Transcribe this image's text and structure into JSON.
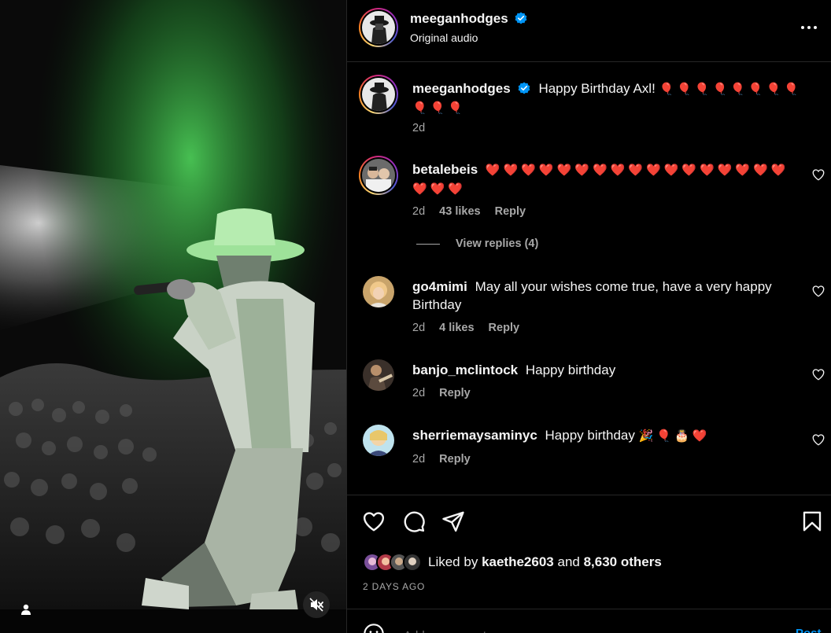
{
  "post": {
    "author": "meeganhodges",
    "audio_label": "Original audio",
    "verified": true
  },
  "caption": {
    "username": "meeganhodges",
    "text": "Happy Birthday Axl!",
    "emojis": "🎈🎈🎈🎈🎈🎈🎈🎈🎈🎈🎈",
    "time": "2d"
  },
  "comments": [
    {
      "username": "betalebeis",
      "text": "",
      "emojis": "❤️❤️❤️❤️❤️❤️❤️❤️❤️❤️❤️❤️❤️❤️❤️❤️❤️❤️❤️❤️",
      "time": "2d",
      "likes": "43 likes",
      "reply": "Reply",
      "view_replies": "View replies (4)"
    },
    {
      "username": "go4mimi",
      "text": "May all your wishes come true, have a very happy Birthday",
      "time": "2d",
      "likes": "4 likes",
      "reply": "Reply"
    },
    {
      "username": "banjo_mclintock",
      "text": "Happy birthday",
      "time": "2d",
      "reply": "Reply"
    },
    {
      "username": "sherriemaysaminyc",
      "text": "Happy birthday",
      "emojis": "🎉🎈🎂❤️",
      "time": "2d",
      "reply": "Reply"
    }
  ],
  "liked_by": {
    "prefix": "Liked by",
    "user": "kaethe2603",
    "joiner": "and",
    "others": "8,630 others"
  },
  "post_date": "2 DAYS AGO",
  "add_comment": {
    "placeholder": "Add a comment...",
    "post_label": "Post"
  },
  "colors": {
    "background": "#000000",
    "secondary_text": "#a8a8a8",
    "verified_blue": "#0095f6",
    "divider": "#262626"
  },
  "icons": [
    "verified-badge-icon",
    "more-options-icon",
    "heart-icon",
    "comment-icon",
    "share-icon",
    "bookmark-icon",
    "user-tag-icon",
    "muted-audio-icon",
    "emoji-icon"
  ]
}
